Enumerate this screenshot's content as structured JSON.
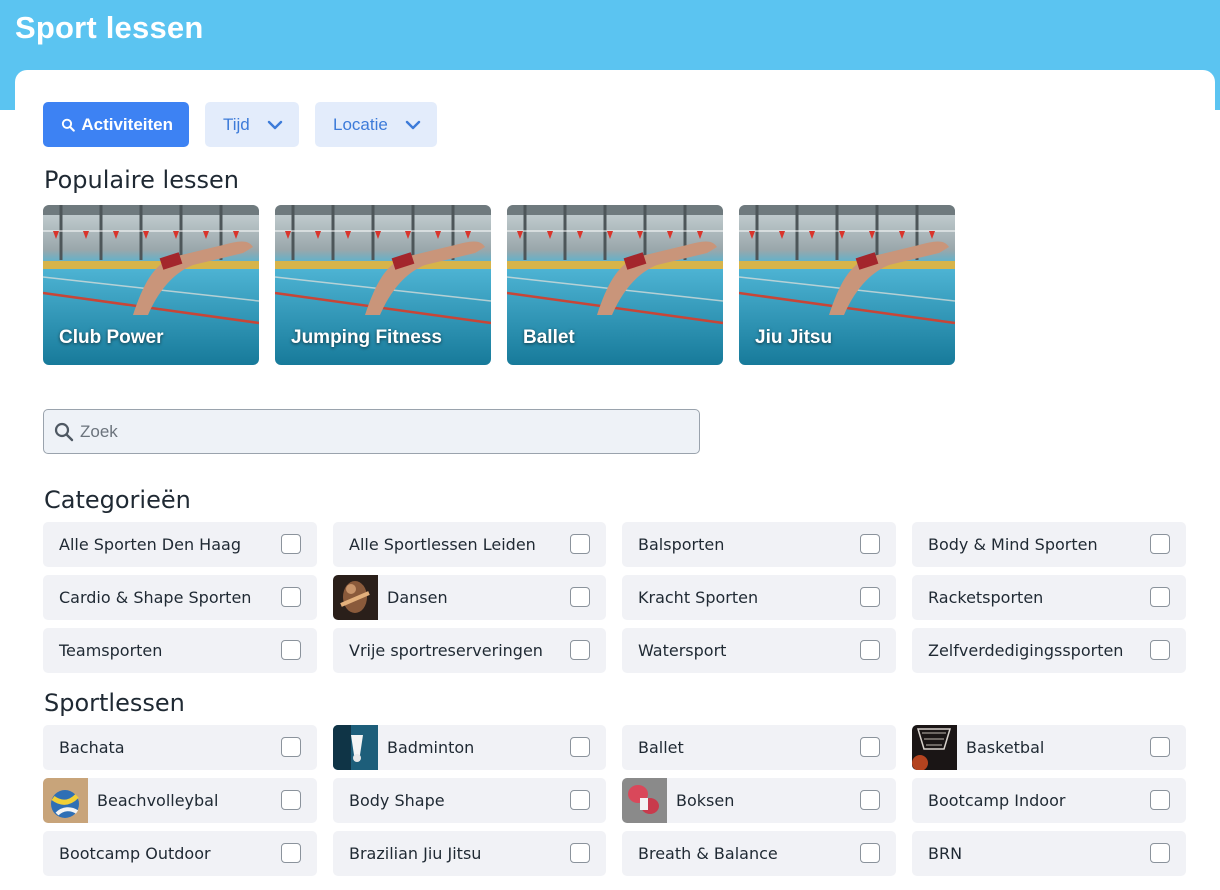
{
  "app": {
    "title": "Sport lessen"
  },
  "filters": {
    "activities_label": "Activiteiten",
    "time_label": "Tijd",
    "location_label": "Locatie"
  },
  "popular": {
    "title": "Populaire lessen",
    "items": [
      {
        "label": "Club Power"
      },
      {
        "label": "Jumping Fitness"
      },
      {
        "label": "Ballet"
      },
      {
        "label": "Jiu Jitsu"
      }
    ]
  },
  "search": {
    "placeholder": "Zoek",
    "value": ""
  },
  "categories": {
    "title": "Categorieën",
    "items": [
      {
        "label": "Alle Sporten Den Haag",
        "checked": false
      },
      {
        "label": "Alle Sportlessen Leiden",
        "checked": false
      },
      {
        "label": "Balsporten",
        "checked": false
      },
      {
        "label": "Body & Mind Sporten",
        "checked": false
      },
      {
        "label": "Cardio & Shape Sporten",
        "checked": false
      },
      {
        "label": "Dansen",
        "checked": false,
        "thumb": "dance-photo"
      },
      {
        "label": "Kracht Sporten",
        "checked": false
      },
      {
        "label": "Racketsporten",
        "checked": false
      },
      {
        "label": "Teamsporten",
        "checked": false
      },
      {
        "label": "Vrije sportreserveringen",
        "checked": false
      },
      {
        "label": "Watersport",
        "checked": false
      },
      {
        "label": "Zelfverdedigingssporten",
        "checked": false
      }
    ]
  },
  "lessons": {
    "title": "Sportlessen",
    "items": [
      {
        "label": "Bachata",
        "checked": false
      },
      {
        "label": "Badminton",
        "checked": false,
        "thumb": "shuttlecock-photo"
      },
      {
        "label": "Ballet",
        "checked": false
      },
      {
        "label": "Basketbal",
        "checked": false,
        "thumb": "basketball-photo"
      },
      {
        "label": "Beachvolleybal",
        "checked": false,
        "thumb": "volleyball-photo"
      },
      {
        "label": "Body Shape",
        "checked": false
      },
      {
        "label": "Boksen",
        "checked": false,
        "thumb": "boxing-glove-photo"
      },
      {
        "label": "Bootcamp Indoor",
        "checked": false
      },
      {
        "label": "Bootcamp Outdoor",
        "checked": false
      },
      {
        "label": "Brazilian Jiu Jitsu",
        "checked": false
      },
      {
        "label": "Breath & Balance",
        "checked": false
      },
      {
        "label": "BRN",
        "checked": false
      }
    ]
  },
  "colors": {
    "header_band": "#5bc4f1",
    "primary": "#3d82f3",
    "soft_button": "#e3ecfb",
    "chip_bg": "#f1f2f6"
  }
}
